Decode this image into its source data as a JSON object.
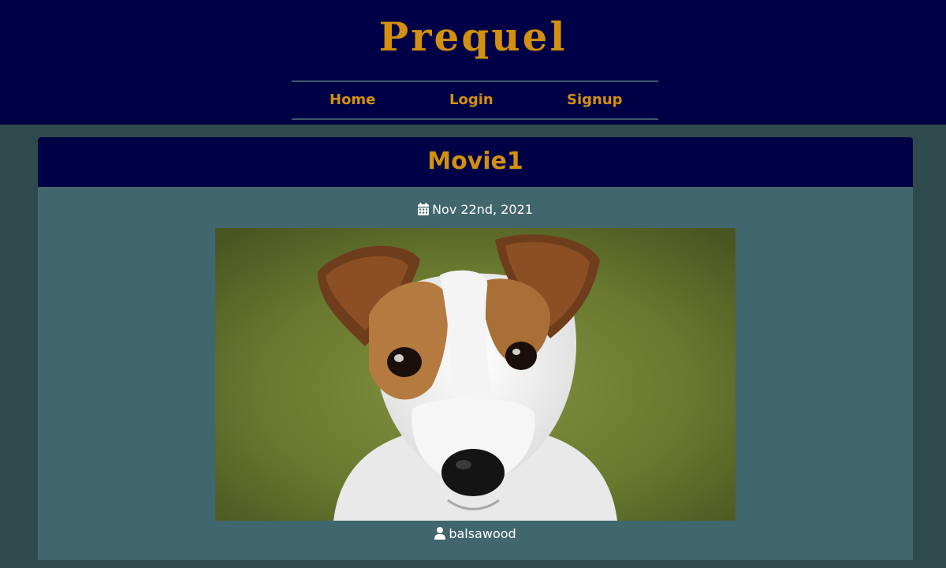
{
  "site": {
    "title": "Prequel"
  },
  "nav": {
    "items": [
      {
        "label": "Home"
      },
      {
        "label": "Login"
      },
      {
        "label": "Signup"
      }
    ]
  },
  "post": {
    "title": "Movie1",
    "date": "Nov 22nd, 2021",
    "author": "balsawood",
    "image_icon": "dog-photo",
    "date_icon": "calendar-icon",
    "author_icon": "user-icon"
  },
  "colors": {
    "header_bg": "#000046",
    "accent_gold": "#d3900e",
    "page_bg": "#2f4a4d",
    "card_bg": "#41666d"
  }
}
